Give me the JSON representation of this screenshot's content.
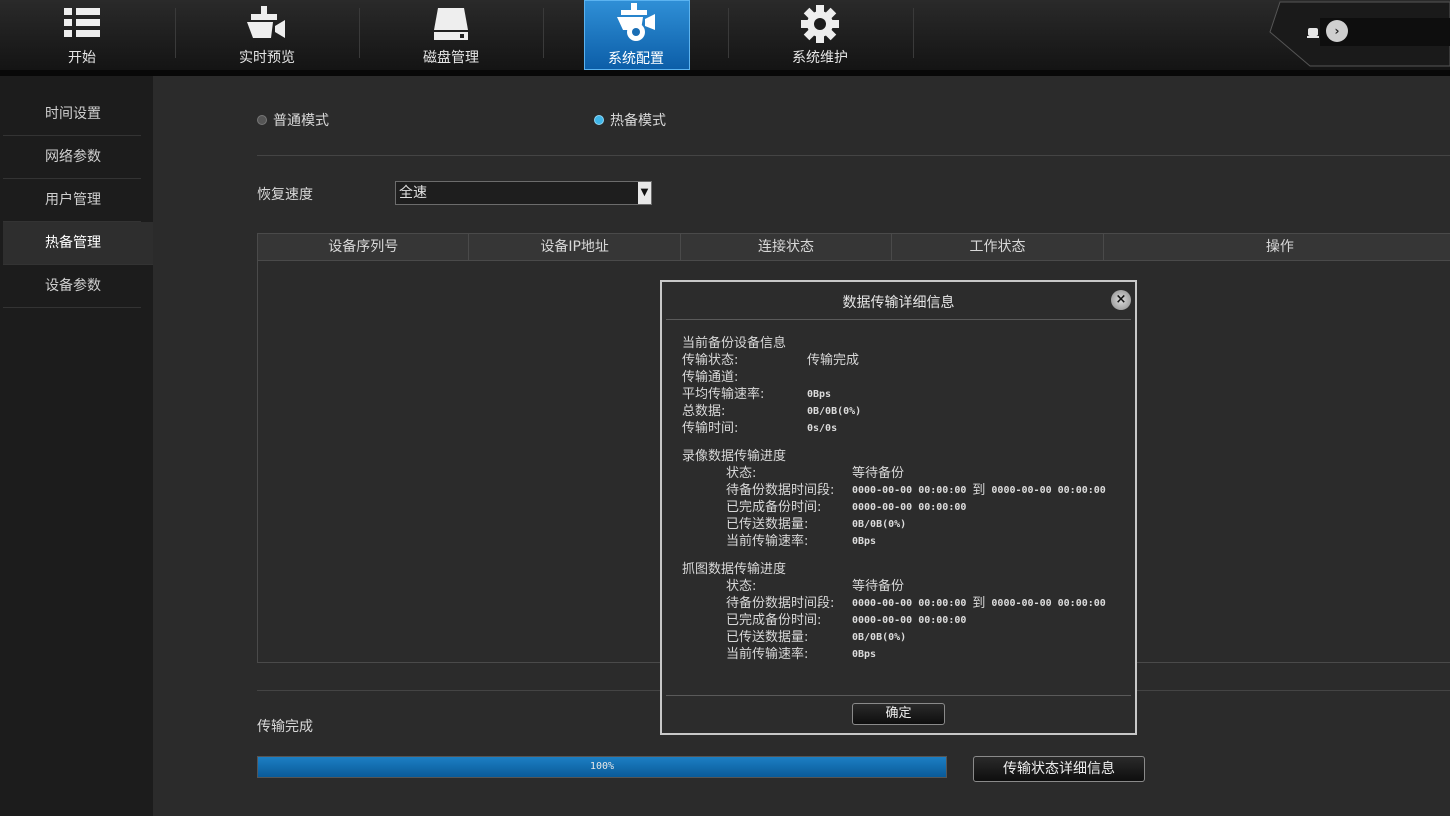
{
  "nav": {
    "items": [
      {
        "label": "开始",
        "icon": "list-icon"
      },
      {
        "label": "实时预览",
        "icon": "camera-icon"
      },
      {
        "label": "磁盘管理",
        "icon": "disk-icon"
      },
      {
        "label": "系统配置",
        "icon": "config-icon",
        "active": true
      },
      {
        "label": "系统维护",
        "icon": "gear-icon"
      }
    ]
  },
  "sidebar": {
    "items": [
      {
        "label": "时间设置"
      },
      {
        "label": "网络参数"
      },
      {
        "label": "用户管理"
      },
      {
        "label": "热备管理",
        "active": true
      },
      {
        "label": "设备参数"
      }
    ]
  },
  "main": {
    "mode_normal": "普通模式",
    "mode_hot": "热备模式",
    "mode_selected": "热备模式",
    "speed_label": "恢复速度",
    "speed_value": "全速",
    "table_headers": [
      "设备序列号",
      "设备IP地址",
      "连接状态",
      "工作状态",
      "操作"
    ],
    "status_text": "传输完成",
    "progress_value": 100,
    "progress_text": "100%",
    "detail_button": "传输状态详细信息"
  },
  "dialog": {
    "title": "数据传输详细信息",
    "current_section": "当前备份设备信息",
    "transfer_status_k": "传输状态:",
    "transfer_status_v": "传输完成",
    "transfer_channel_k": "传输通道:",
    "avg_rate_k": "平均传输速率:",
    "avg_rate_v": "0Bps",
    "total_k": "总数据:",
    "total_v": "0B/0B(0%)",
    "time_k": "传输时间:",
    "time_v": "0s/0s",
    "record_section": "录像数据传输进度",
    "record": {
      "state_k": "状态:",
      "state_v": "等待备份",
      "period_k": "待备份数据时间段:",
      "period_from": "0000-00-00 00:00:00",
      "period_to_word": "到",
      "period_to": "0000-00-00 00:00:00",
      "done_k": "已完成备份时间:",
      "done_v": "0000-00-00 00:00:00",
      "sent_k": "已传送数据量:",
      "sent_v": "0B/0B(0%)",
      "rate_k": "当前传输速率:",
      "rate_v": "0Bps"
    },
    "snapshot_section": "抓图数据传输进度",
    "snapshot": {
      "state_k": "状态:",
      "state_v": "等待备份",
      "period_k": "待备份数据时间段:",
      "period_from": "0000-00-00 00:00:00",
      "period_to_word": "到",
      "period_to": "0000-00-00 00:00:00",
      "done_k": "已完成备份时间:",
      "done_v": "0000-00-00 00:00:00",
      "sent_k": "已传送数据量:",
      "sent_v": "0B/0B(0%)",
      "rate_k": "当前传输速率:",
      "rate_v": "0Bps"
    },
    "ok_button": "确定"
  },
  "colors": {
    "accent": "#1c7fc4",
    "radio_checked": "#3fb6e9"
  }
}
